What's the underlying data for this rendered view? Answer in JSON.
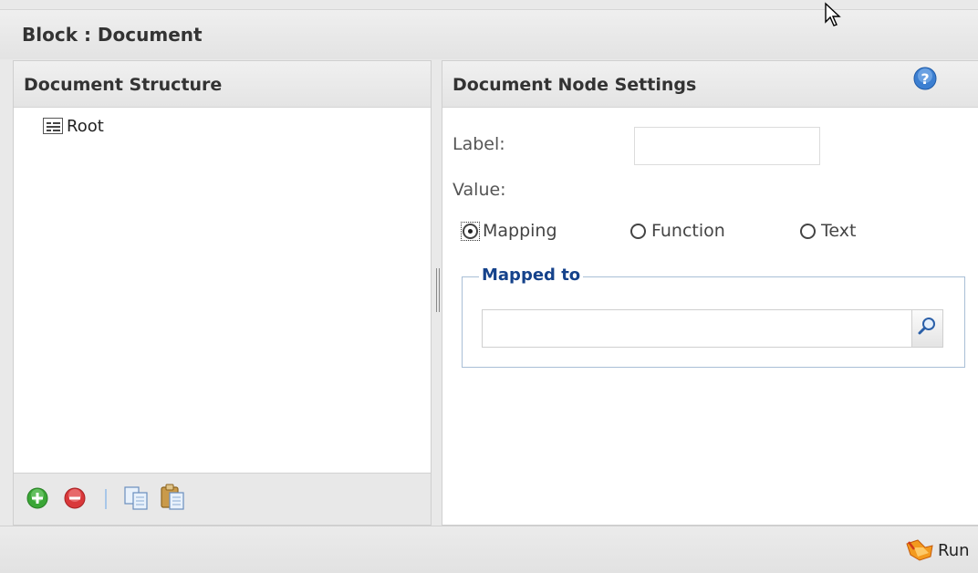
{
  "window": {
    "title": "Block : Document"
  },
  "left_panel": {
    "title": "Document Structure",
    "tree": {
      "root_label": "Root"
    },
    "toolbar": {
      "add": "add-icon",
      "remove": "remove-icon",
      "copy": "copy-icon",
      "paste": "paste-icon"
    }
  },
  "right_panel": {
    "title": "Document Node Settings",
    "label_field": {
      "label": "Label:",
      "value": ""
    },
    "value_field": {
      "label": "Value:"
    },
    "radios": [
      {
        "label": "Mapping",
        "checked": true
      },
      {
        "label": "Function",
        "checked": false
      },
      {
        "label": "Text",
        "checked": false
      }
    ],
    "mapped_to": {
      "legend": "Mapped to",
      "value": ""
    }
  },
  "bottom_bar": {
    "run_label": "Run"
  },
  "colors": {
    "legend_text": "#15428b",
    "help_icon": "#3c7fd1",
    "add_icon": "#3aa636",
    "remove_icon": "#d9383a"
  }
}
